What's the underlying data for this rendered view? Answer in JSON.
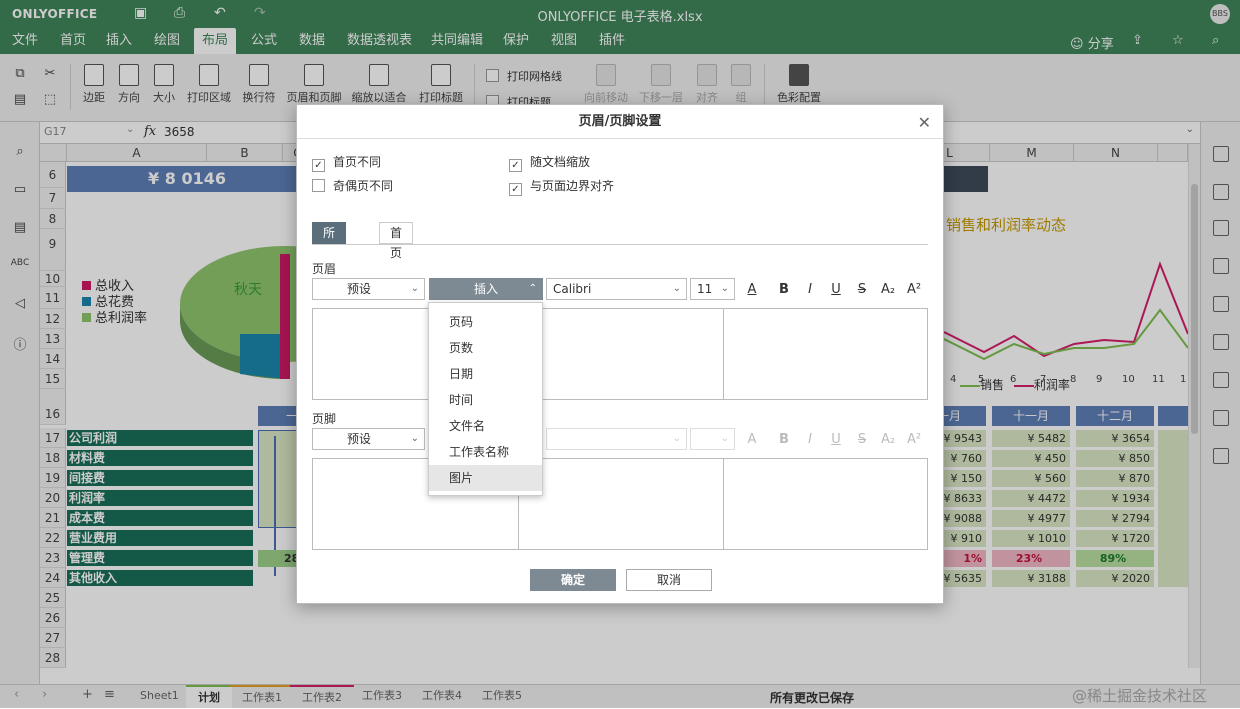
{
  "app": {
    "logo": "ONLYOFFICE",
    "title": "ONLYOFFICE 电子表格.xlsx",
    "avatar": "BBS"
  },
  "menu": [
    "文件",
    "首页",
    "插入",
    "绘图",
    "布局",
    "公式",
    "数据",
    "数据透视表",
    "共同编辑",
    "保护",
    "视图",
    "插件"
  ],
  "menu_active": "布局",
  "menu_right": {
    "share": "分享"
  },
  "toolbar": {
    "margin": "边距",
    "orientation": "方向",
    "size": "大小",
    "print_area": "打印区域",
    "line_break": "换行符",
    "header_footer": "页眉和页脚",
    "fit": "缩放以适合",
    "print_titles": "打印标题",
    "gridlines": "打印网格线",
    "headings": "打印标题",
    "forward": "向前移动",
    "backward": "下移一层",
    "align": "对齐",
    "group": "组",
    "color_scheme": "色彩配置"
  },
  "formula": {
    "cellref": "G17",
    "fx": "fx",
    "value": "3658"
  },
  "columns": [
    "A",
    "B",
    "C",
    "L",
    "M",
    "N"
  ],
  "rows": [
    "6",
    "7",
    "8",
    "9",
    "10",
    "11",
    "12",
    "13",
    "14",
    "15",
    "16",
    "17",
    "18",
    "19",
    "20",
    "21",
    "22",
    "23",
    "24",
    "25",
    "26",
    "27",
    "28"
  ],
  "sheet": {
    "banner": "¥ 8 0146",
    "legend": [
      "总收入",
      "总花费",
      "总利润率"
    ],
    "pie_label": "秋天",
    "chart_title": "销售和利润率动态",
    "chart_legend": [
      "销售",
      "利润率"
    ],
    "chart_xticks": [
      "4",
      "5",
      "6",
      "7",
      "8",
      "9",
      "10",
      "11",
      "1"
    ],
    "labels": [
      "公司利润",
      "材料费",
      "间接费",
      "利润率",
      "成本费",
      "营业费用",
      "管理费",
      "其他收入"
    ],
    "month_headers": [
      "一月",
      "十一月",
      "十二月"
    ],
    "col_l": [
      "¥ 9543",
      "¥ 760",
      "¥ 150",
      "¥ 8633",
      "¥ 9088",
      "¥ 910",
      "1%",
      "¥ 5635"
    ],
    "col_m": [
      "¥ 5482",
      "¥ 450",
      "¥ 560",
      "¥ 4472",
      "¥ 4977",
      "¥ 1010",
      "23%",
      "¥ 3188"
    ],
    "col_n": [
      "¥ 3654",
      "¥ 850",
      "¥ 870",
      "¥ 1934",
      "¥ 2794",
      "¥ 1720",
      "89%",
      "¥ 2020"
    ],
    "b23": "28"
  },
  "status": {
    "sheets": [
      "Sheet1",
      "计划",
      "工作表1",
      "工作表2",
      "工作表3",
      "工作表4",
      "工作表5"
    ],
    "active_sheet": "计划",
    "saved": "所有更改已保存",
    "watermark": "@稀土掘金技术社区"
  },
  "dialog": {
    "title": "页眉/页脚设置",
    "checks": [
      {
        "label": "首页不同",
        "checked": true
      },
      {
        "label": "奇偶页不同",
        "checked": false
      },
      {
        "label": "随文档缩放",
        "checked": true
      },
      {
        "label": "与页面边界对齐",
        "checked": true
      }
    ],
    "tabs": [
      "所有页面",
      "首页"
    ],
    "header_label": "页眉",
    "footer_label": "页脚",
    "preset": "预设",
    "insert": "插入",
    "font": "Calibri",
    "size": "11",
    "fmt": [
      "A",
      "B",
      "I",
      "U",
      "S",
      "A₂",
      "A²"
    ],
    "dropdown": [
      "页码",
      "页数",
      "日期",
      "时间",
      "文件名",
      "工作表名称",
      "图片"
    ],
    "ok": "确定",
    "cancel": "取消"
  }
}
